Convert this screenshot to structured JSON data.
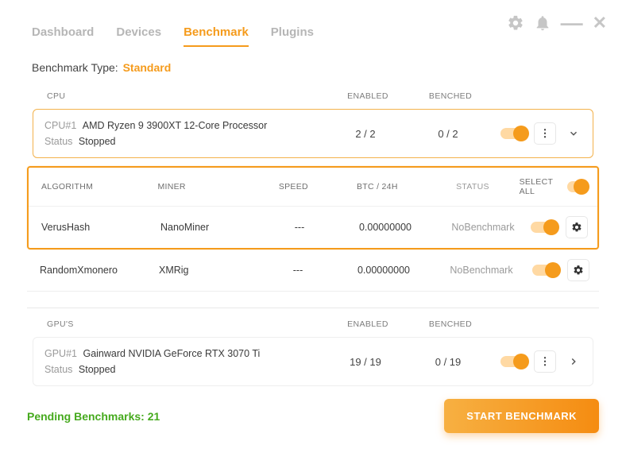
{
  "tabs": {
    "dashboard": "Dashboard",
    "devices": "Devices",
    "benchmark": "Benchmark",
    "plugins": "Plugins"
  },
  "benchmarkType": {
    "label": "Benchmark Type:",
    "value": "Standard"
  },
  "cpuSection": {
    "title": "CPU",
    "enabledHeader": "ENABLED",
    "benchedHeader": "BENCHED",
    "device": {
      "id": "CPU#1",
      "name": "AMD Ryzen 9 3900XT 12-Core Processor",
      "statusLabel": "Status",
      "statusValue": "Stopped",
      "enabled": "2 / 2",
      "benched": "0 / 2"
    }
  },
  "algoTable": {
    "headers": {
      "algorithm": "ALGORITHM",
      "miner": "MINER",
      "speed": "SPEED",
      "btc": "BTC / 24H",
      "status": "STATUS",
      "selectAll": "SELECT ALL"
    },
    "rows": [
      {
        "algorithm": "VerusHash",
        "miner": "NanoMiner",
        "speed": "---",
        "btc": "0.00000000",
        "status": "NoBenchmark"
      },
      {
        "algorithm": "RandomXmonero",
        "miner": "XMRig",
        "speed": "---",
        "btc": "0.00000000",
        "status": "NoBenchmark"
      }
    ]
  },
  "gpuSection": {
    "title": "GPU'S",
    "enabledHeader": "ENABLED",
    "benchedHeader": "BENCHED",
    "device": {
      "id": "GPU#1",
      "name": "Gainward NVIDIA GeForce RTX 3070 Ti",
      "statusLabel": "Status",
      "statusValue": "Stopped",
      "enabled": "19 / 19",
      "benched": "0 / 19"
    }
  },
  "footer": {
    "pendingLabel": "Pending Benchmarks: ",
    "pendingCount": "21",
    "startButton": "START BENCHMARK"
  }
}
